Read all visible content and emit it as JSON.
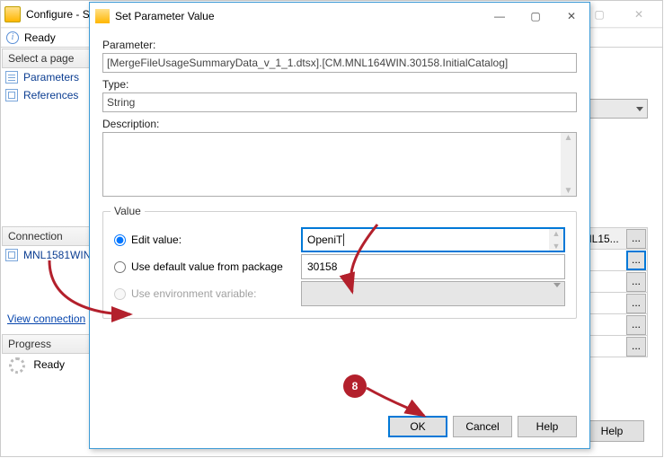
{
  "parent_window": {
    "title": "Configure - S",
    "ready": "Ready",
    "select_page": "Select a page",
    "pages": [
      "Parameters",
      "References"
    ],
    "connection_hdr": "Connection",
    "connection_node": "MNL1581WIN",
    "view_connection": "View connection",
    "progress_hdr": "Progress",
    "progress_status": "Ready",
    "grid_header": "MNL15...",
    "ellipsis": "...",
    "help": "Help"
  },
  "dialog": {
    "title": "Set Parameter Value",
    "parameter_label": "Parameter:",
    "parameter_value": "[MergeFileUsageSummaryData_v_1_1.dtsx].[CM.MNL164WIN.30158.InitialCatalog]",
    "type_label": "Type:",
    "type_value": "String",
    "description_label": "Description:",
    "value_legend": "Value",
    "edit_value_label": "Edit value:",
    "edit_value_text": "OpeniT",
    "default_label": "Use default value from package",
    "default_value": "30158",
    "env_label": "Use environment variable:",
    "ok": "OK",
    "cancel": "Cancel",
    "help": "Help"
  },
  "annotation": {
    "badge": "8"
  }
}
